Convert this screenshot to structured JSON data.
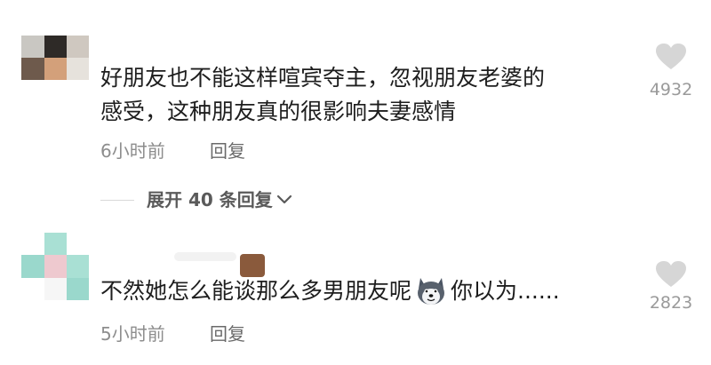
{
  "comments": [
    {
      "text_line1": "好朋友也不能这样喧宾夺主，忽视朋友老婆的",
      "text_line2": "感受，这种朋友真的很影响夫妻感情",
      "time": "6小时前",
      "reply_label": "回复",
      "likes": "4932",
      "expand_replies": "展开 40 条回复"
    },
    {
      "text_before_emoji": "不然她怎么能谈那么多男朋友呢",
      "emoji": "husky-emoji",
      "text_after_emoji": "你以为......",
      "time": "5小时前",
      "reply_label": "回复",
      "likes": "2823"
    }
  ],
  "icons": {
    "like": "heart-icon",
    "expand": "chevron-down-icon"
  },
  "colors": {
    "text": "#1e1e1e",
    "meta": "#8d8d8d",
    "heart": "#d6d6d6",
    "avatar1": [
      "#c9c7c2",
      "#2e2a27",
      "#cfc8c0",
      "#6e5a4c",
      "#d3a07a",
      "#e6e2dc"
    ],
    "avatar2": [
      "#9ad8cc",
      "#eec9cf",
      "#a9e0d4",
      "#f6f6f6"
    ]
  }
}
